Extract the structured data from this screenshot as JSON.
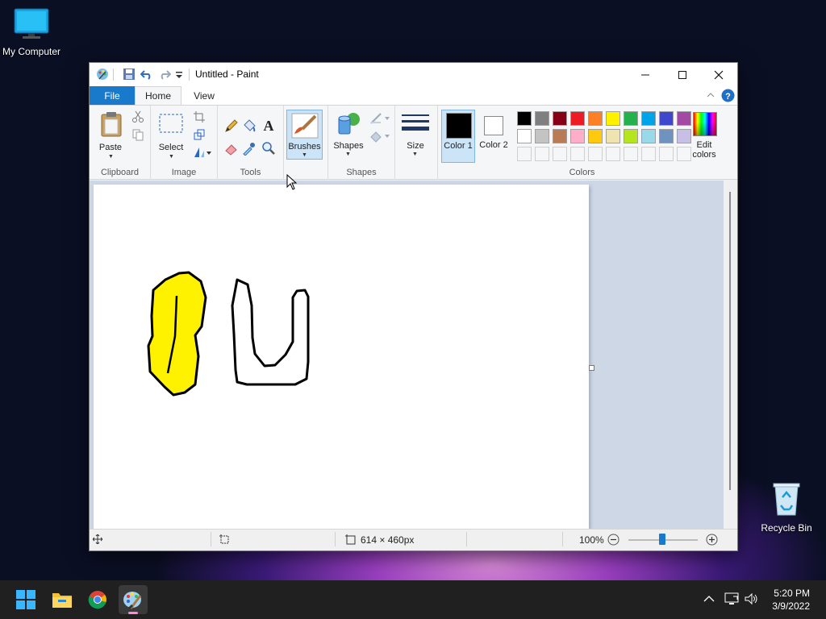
{
  "desktop": {
    "icons": [
      {
        "label": "My Computer",
        "icon": "monitor-icon"
      },
      {
        "label": "Recycle Bin",
        "icon": "recycle-bin-icon"
      }
    ]
  },
  "window": {
    "title": "Untitled - Paint",
    "tabs": {
      "file": "File",
      "home": "Home",
      "view": "View"
    },
    "ribbon": {
      "clipboard": {
        "label": "Clipboard",
        "paste": "Paste"
      },
      "image": {
        "label": "Image",
        "select": "Select"
      },
      "tools": {
        "label": "Tools"
      },
      "brushes": {
        "label": "Brushes"
      },
      "shapes": {
        "label": "Shapes",
        "shapes_btn": "Shapes"
      },
      "size": {
        "label": "Size"
      },
      "colors": {
        "label": "Colors",
        "color1": "Color 1",
        "color2": "Color 2",
        "edit_colors": "Edit colors",
        "color1_value": "#000000",
        "color2_value": "#ffffff",
        "palette_row1": [
          "#000000",
          "#7f7f7f",
          "#880015",
          "#ed1c24",
          "#ff7f27",
          "#fff200",
          "#22b14c",
          "#00a2e8",
          "#3f48cc",
          "#a349a4"
        ],
        "palette_row2": [
          "#ffffff",
          "#c3c3c3",
          "#b97a57",
          "#ffaec9",
          "#ffc90e",
          "#efe4b0",
          "#b5e61d",
          "#99d9ea",
          "#7092be",
          "#c8bfe7"
        ]
      }
    },
    "status": {
      "canvas_size": "614 × 460px",
      "zoom": "100%"
    }
  },
  "taskbar": {
    "apps": [
      "start-icon",
      "file-explorer-icon",
      "chrome-icon",
      "paint-icon"
    ],
    "time": "5:20 PM",
    "date": "3/9/2022"
  }
}
